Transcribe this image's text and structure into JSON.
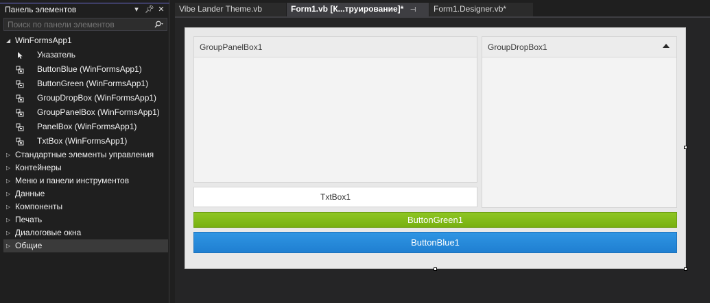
{
  "toolbox": {
    "title": "Панель элементов",
    "search_placeholder": "Поиск по панели элементов",
    "project": "WinFormsApp1",
    "items": [
      {
        "label": "Указатель",
        "icon": "pointer-icon"
      },
      {
        "label": "ButtonBlue (WinFormsApp1)",
        "icon": "component-icon"
      },
      {
        "label": "ButtonGreen (WinFormsApp1)",
        "icon": "component-icon"
      },
      {
        "label": "GroupDropBox (WinFormsApp1)",
        "icon": "component-icon"
      },
      {
        "label": "GroupPanelBox (WinFormsApp1)",
        "icon": "component-icon"
      },
      {
        "label": "PanelBox (WinFormsApp1)",
        "icon": "component-icon"
      },
      {
        "label": "TxtBox (WinFormsApp1)",
        "icon": "component-icon"
      }
    ],
    "categories": [
      "Стандартные элементы управления",
      "Контейнеры",
      "Меню и панели инструментов",
      "Данные",
      "Компоненты",
      "Печать",
      "Диалоговые окна",
      "Общие"
    ],
    "selected_category": "Общие"
  },
  "tabs": [
    {
      "label": "Vibe Lander Theme.vb",
      "active": false
    },
    {
      "label": "Form1.vb [К...труирование]*",
      "active": true
    },
    {
      "label": "Form1.Designer.vb*",
      "active": false
    }
  ],
  "form": {
    "group_panel_title": "GroupPanelBox1",
    "group_drop_title": "GroupDropBox1",
    "txtbox_text": "TxtBox1",
    "button_green_text": "ButtonGreen1",
    "button_blue_text": "ButtonBlue1"
  },
  "colors": {
    "accent_green": "#82bc1a",
    "accent_blue": "#2589dc",
    "panel_bg": "#1f1f1f"
  }
}
